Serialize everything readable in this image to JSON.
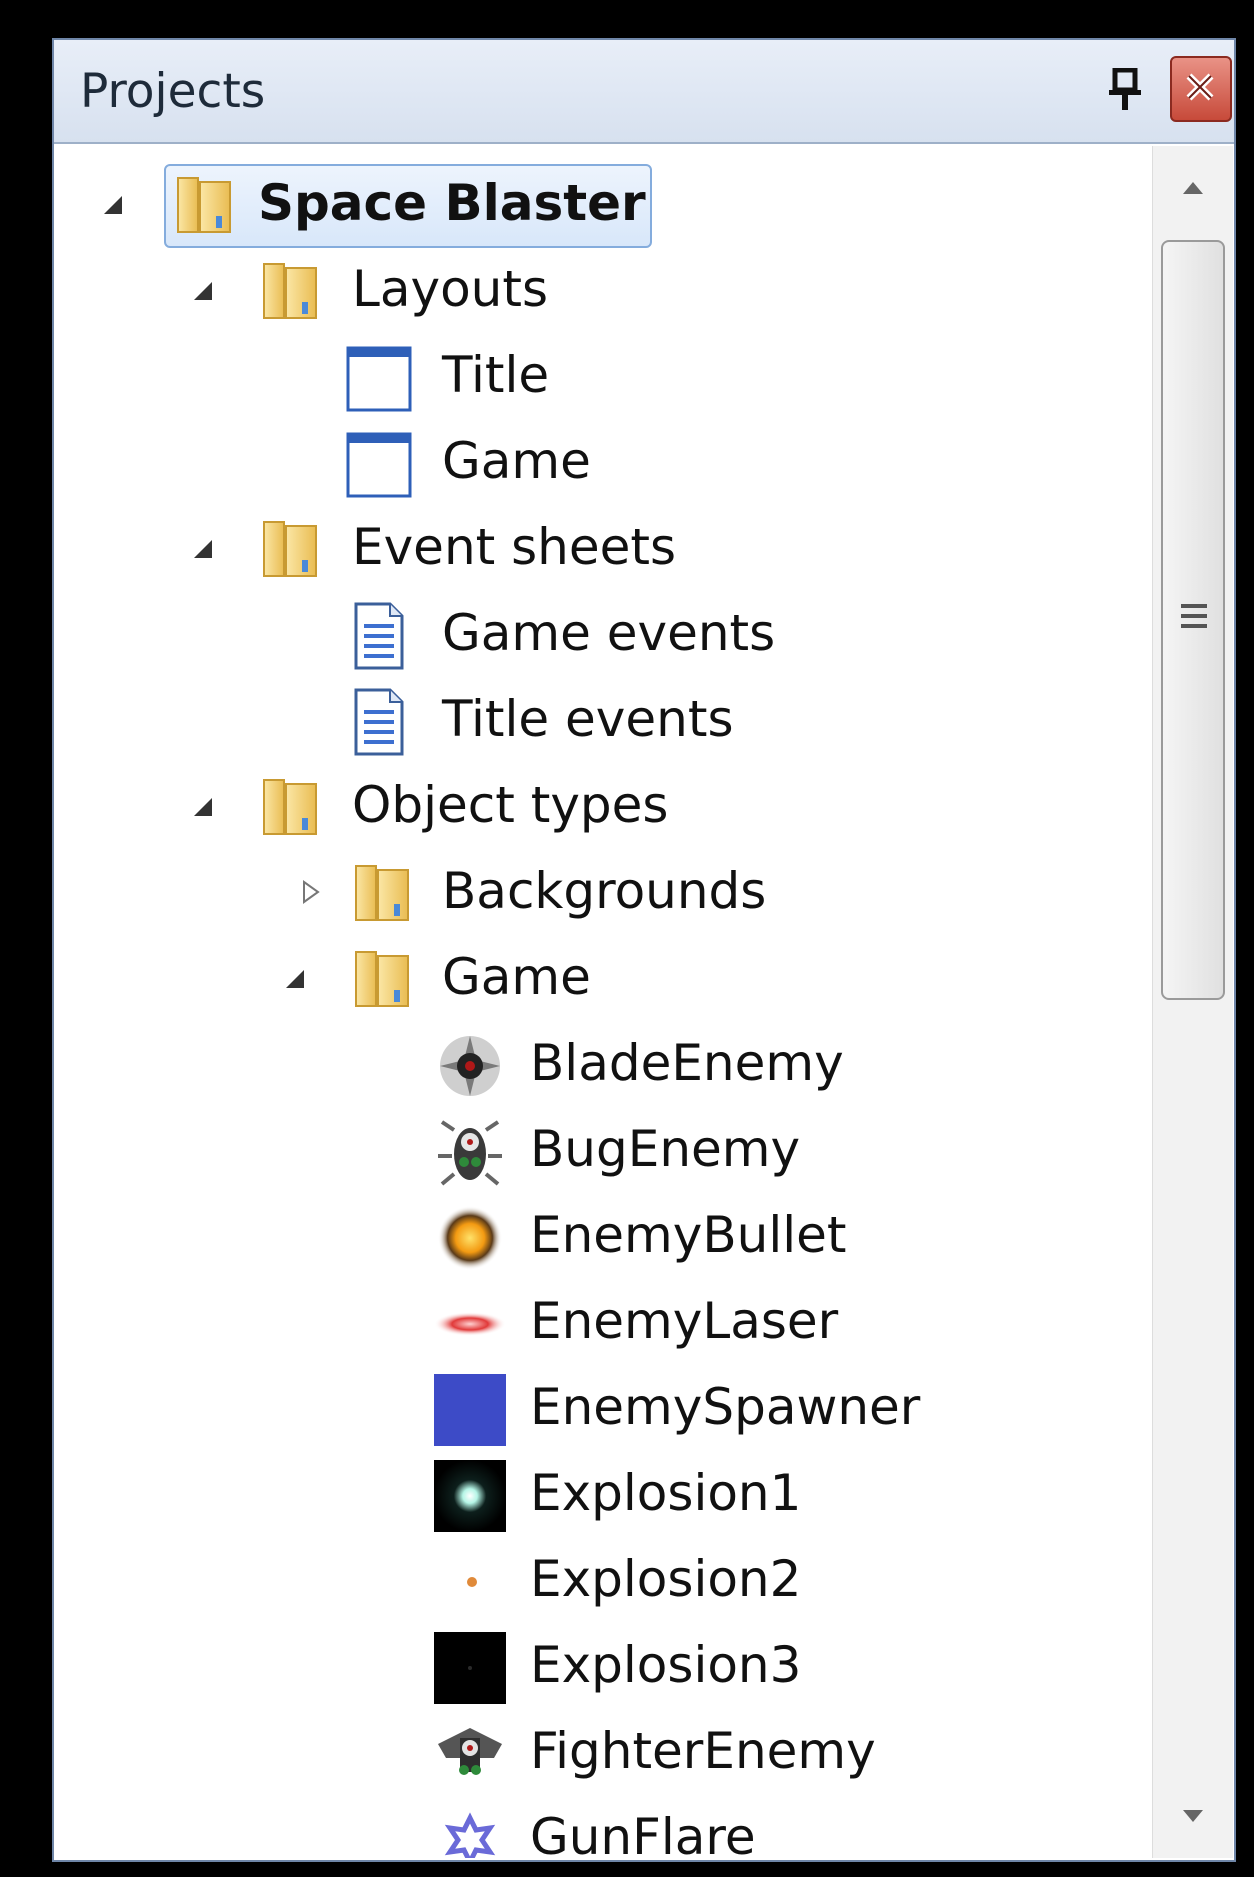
{
  "panel": {
    "title": "Projects"
  },
  "tree": {
    "root": {
      "label": "Space Blaster",
      "expanded": true,
      "selected": true,
      "icon": "folder-icon"
    },
    "layouts": {
      "label": "Layouts",
      "expanded": true,
      "icon": "folder-icon",
      "items": [
        {
          "label": "Title",
          "icon": "layout-icon"
        },
        {
          "label": "Game",
          "icon": "layout-icon"
        }
      ]
    },
    "event_sheets": {
      "label": "Event sheets",
      "expanded": true,
      "icon": "folder-icon",
      "items": [
        {
          "label": "Game events",
          "icon": "event-sheet-icon"
        },
        {
          "label": "Title events",
          "icon": "event-sheet-icon"
        }
      ]
    },
    "object_types": {
      "label": "Object types",
      "expanded": true,
      "icon": "folder-icon",
      "backgrounds": {
        "label": "Backgrounds",
        "expanded": false,
        "icon": "folder-icon"
      },
      "game": {
        "label": "Game",
        "expanded": true,
        "icon": "folder-icon",
        "items": [
          {
            "label": "BladeEnemy",
            "icon": "blade-enemy-sprite-icon"
          },
          {
            "label": "BugEnemy",
            "icon": "bug-enemy-sprite-icon"
          },
          {
            "label": "EnemyBullet",
            "icon": "enemy-bullet-sprite-icon"
          },
          {
            "label": "EnemyLaser",
            "icon": "enemy-laser-sprite-icon"
          },
          {
            "label": "EnemySpawner",
            "icon": "enemy-spawner-sprite-icon"
          },
          {
            "label": "Explosion1",
            "icon": "explosion1-sprite-icon"
          },
          {
            "label": "Explosion2",
            "icon": "explosion2-sprite-icon"
          },
          {
            "label": "Explosion3",
            "icon": "explosion3-sprite-icon"
          },
          {
            "label": "FighterEnemy",
            "icon": "fighter-enemy-sprite-icon"
          },
          {
            "label": "GunFlare",
            "icon": "gun-flare-sprite-icon"
          }
        ]
      }
    }
  },
  "colors": {
    "folder": "#f2cd6e",
    "selection_border": "#84acdd",
    "layout_blue": "#2e5fb8",
    "spawner_blue": "#3d4bc7"
  }
}
